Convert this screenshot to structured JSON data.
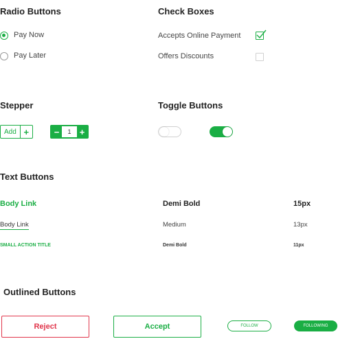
{
  "colors": {
    "accent": "#1aae44",
    "danger": "#e0344a"
  },
  "radio": {
    "title": "Radio Buttons",
    "options": [
      {
        "label": "Pay Now",
        "selected": true
      },
      {
        "label": "Pay Later",
        "selected": false
      }
    ]
  },
  "checkboxes": {
    "title": "Check Boxes",
    "options": [
      {
        "label": "Accepts Online Payment",
        "checked": true
      },
      {
        "label": "Offers Discounts",
        "checked": false
      }
    ]
  },
  "stepper": {
    "title": "Stepper",
    "add_label": "Add",
    "plus": "+",
    "minus": "−",
    "value": "1"
  },
  "toggles": {
    "title": "Toggle Buttons",
    "states": [
      "off",
      "on"
    ]
  },
  "text_buttons": {
    "title": "Text Buttons",
    "rows": [
      {
        "sample": "Body Link",
        "weight": "Demi Bold",
        "size": "15px"
      },
      {
        "sample": "Body Link",
        "weight": "Medium",
        "size": "13px"
      },
      {
        "sample": "SMALL ACTION TITLE",
        "weight": "Demi Bold",
        "size": "11px"
      }
    ]
  },
  "outlined": {
    "title": "Outlined Buttons",
    "reject": "Reject",
    "accept": "Accept",
    "follow": "FOLLOW",
    "following": "FOLLOWING"
  }
}
